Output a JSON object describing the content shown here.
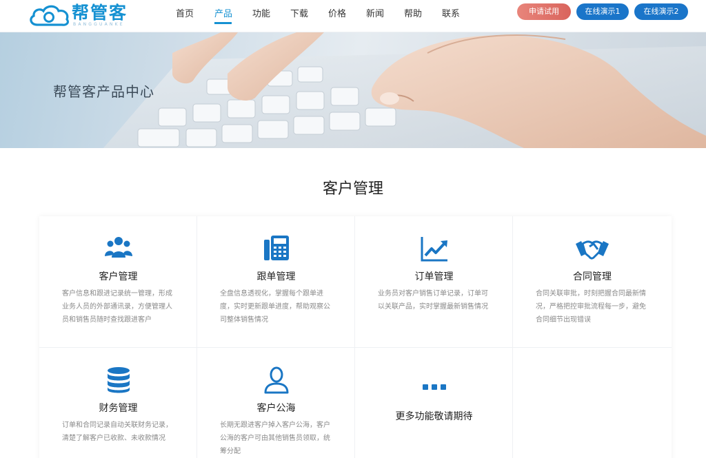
{
  "brand": {
    "name": "帮管客",
    "sub": "BANGGUANKE",
    "color": "#1591d2"
  },
  "nav": {
    "items": [
      {
        "label": "首页",
        "active": false
      },
      {
        "label": "产品",
        "active": true
      },
      {
        "label": "功能",
        "active": false
      },
      {
        "label": "下载",
        "active": false
      },
      {
        "label": "价格",
        "active": false
      },
      {
        "label": "新闻",
        "active": false
      },
      {
        "label": "帮助",
        "active": false
      },
      {
        "label": "联系",
        "active": false
      }
    ]
  },
  "actions": {
    "trial": "申请试用",
    "demo1": "在线演示1",
    "demo2": "在线演示2"
  },
  "banner": {
    "title": "帮管客产品中心"
  },
  "section": {
    "title": "客户管理",
    "cards": [
      {
        "title": "客户管理",
        "icon": "users-icon",
        "desc": "客户信息和跟进记录统一管理，形成业务人员的外部通讯录，方便管理人员和销售员随时查找跟进客户"
      },
      {
        "title": "跟单管理",
        "icon": "fax-phone-icon",
        "desc": "全盘信息透视化，掌握每个跟单进度，实时更新跟单进度，帮助观察公司整体销售情况"
      },
      {
        "title": "订单管理",
        "icon": "line-chart-icon",
        "desc": "业务员对客户销售订单记录，订单可以关联产品，实时掌握最新销售情况"
      },
      {
        "title": "合同管理",
        "icon": "handshake-icon",
        "desc": "合同关联审批，时刻把握合同最新情况，严格把控审批流程每一步，避免合同细节出现错误"
      },
      {
        "title": "财务管理",
        "icon": "database-icon",
        "desc": "订单和合同记录自动关联财务记录，清楚了解客户已收款、未收款情况"
      },
      {
        "title": "客户公海",
        "icon": "user-outline-icon",
        "desc": "长期无跟进客户掉入客户公海，客户公海的客户可由其他销售员领取，统筹分配"
      },
      {
        "title": "更多功能敬请期待",
        "icon": "more-dots-icon",
        "desc": ""
      }
    ]
  },
  "colors": {
    "accent": "#1591d2",
    "icon_blue": "#1a76c4",
    "trial_button": "#e07368",
    "demo_button": "#1a75c9"
  }
}
